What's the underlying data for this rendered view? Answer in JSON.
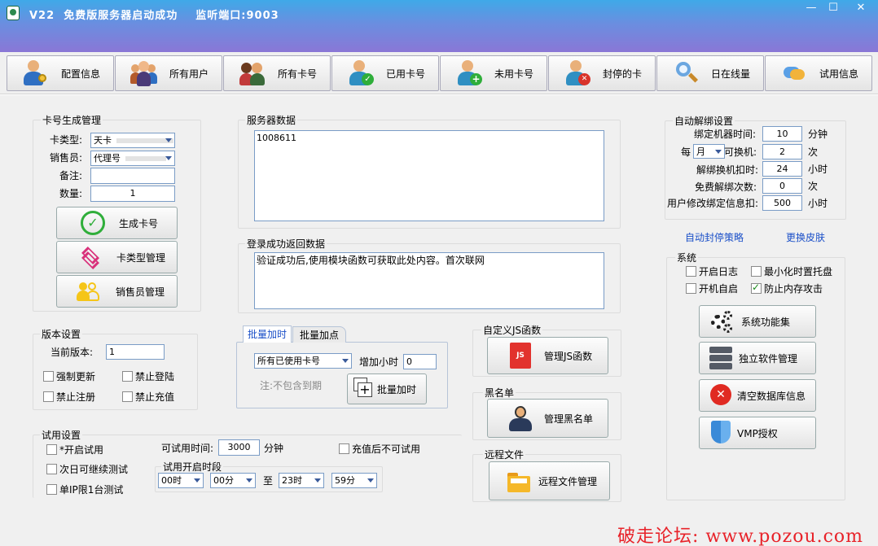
{
  "window": {
    "title": "V22  免费版服务器启动成功    监听端口:9003",
    "controls": {
      "min": "—",
      "max": "☐",
      "close": "✕"
    }
  },
  "toolbar": {
    "buttons": [
      {
        "label": "配置信息",
        "icon": "user-config-icon"
      },
      {
        "label": "所有用户",
        "icon": "users-group-icon"
      },
      {
        "label": "所有卡号",
        "icon": "users-pair-icon"
      },
      {
        "label": "已用卡号",
        "icon": "user-check-icon"
      },
      {
        "label": "未用卡号",
        "icon": "user-add-icon"
      },
      {
        "label": "封停的卡",
        "icon": "user-block-icon"
      },
      {
        "label": "日在线量",
        "icon": "magnifier-icon"
      },
      {
        "label": "试用信息",
        "icon": "chat-bubble-icon"
      }
    ]
  },
  "card_gen": {
    "title": "卡号生成管理",
    "type_label": "卡类型:",
    "type_value": "天卡",
    "seller_label": "销售员:",
    "seller_value": "代理号",
    "note_label": "备注:",
    "note_value": "",
    "qty_label": "数量:",
    "qty_value": "1",
    "gen_button": "生成卡号",
    "type_mgr_button": "卡类型管理",
    "seller_mgr_button": "销售员管理"
  },
  "version": {
    "title": "版本设置",
    "current_label": "当前版本:",
    "current_value": "1",
    "force_update": "强制更新",
    "no_login": "禁止登陆",
    "no_register": "禁止注册",
    "no_recharge": "禁止充值"
  },
  "trial": {
    "title": "试用设置",
    "enable": "*开启试用",
    "next_day": "次日可继续测试",
    "single_ip": "单IP限1台测试",
    "time_label": "可试用时间:",
    "time_value": "3000",
    "time_unit": "分钟",
    "no_trial_after": "充值后不可试用",
    "period_title": "试用开启时段",
    "h1": "00时",
    "m1": "00分",
    "to": "至",
    "h2": "23时",
    "m2": "59分"
  },
  "server": {
    "title": "服务器数据",
    "value": "1008611"
  },
  "login": {
    "title": "登录成功返回数据",
    "value": "验证成功后,使用模块函数可获取此处内容。首次联网"
  },
  "batch": {
    "tab1": "批量加时",
    "tab2": "批量加点",
    "filter": "所有已使用卡号",
    "add_label": "增加小时",
    "add_value": "0",
    "note": "注:不包含到期",
    "button": "批量加时"
  },
  "js": {
    "title": "自定义JS函数",
    "button": "管理JS函数",
    "icon_text": "JS"
  },
  "blacklist": {
    "title": "黑名单",
    "button": "管理黑名单"
  },
  "remote": {
    "title": "远程文件",
    "button": "远程文件管理"
  },
  "unbind": {
    "title": "自动解绑设置",
    "r1_label": "绑定机器时间:",
    "r1_value": "10",
    "r1_unit": "分钟",
    "r2_prefix": "每",
    "r2_select": "月",
    "r2_label": "可换机:",
    "r2_value": "2",
    "r2_unit": "次",
    "r3_label": "解绑换机扣时:",
    "r3_value": "24",
    "r3_unit": "小时",
    "r4_label": "免费解绑次数:",
    "r4_value": "0",
    "r4_unit": "次",
    "r5_label": "用户修改绑定信息扣:",
    "r5_value": "500",
    "r5_unit": "小时"
  },
  "links": {
    "auto_block": "自动封停策略",
    "skin": "更换皮肤"
  },
  "system": {
    "title": "系统",
    "log": "开启日志",
    "tray": "最小化时置托盘",
    "autostart": "开机自启",
    "anti_mem": "防止内存攻击",
    "b1": "系统功能集",
    "b2": "独立软件管理",
    "b3": "清空数据库信息",
    "b4": "VMP授权"
  },
  "watermark": "破走论坛: www.pozou.com",
  "colors": {
    "accent": "#1a4fc8",
    "watermark": "#e8232a",
    "titlebar": "#6a8ee0"
  }
}
